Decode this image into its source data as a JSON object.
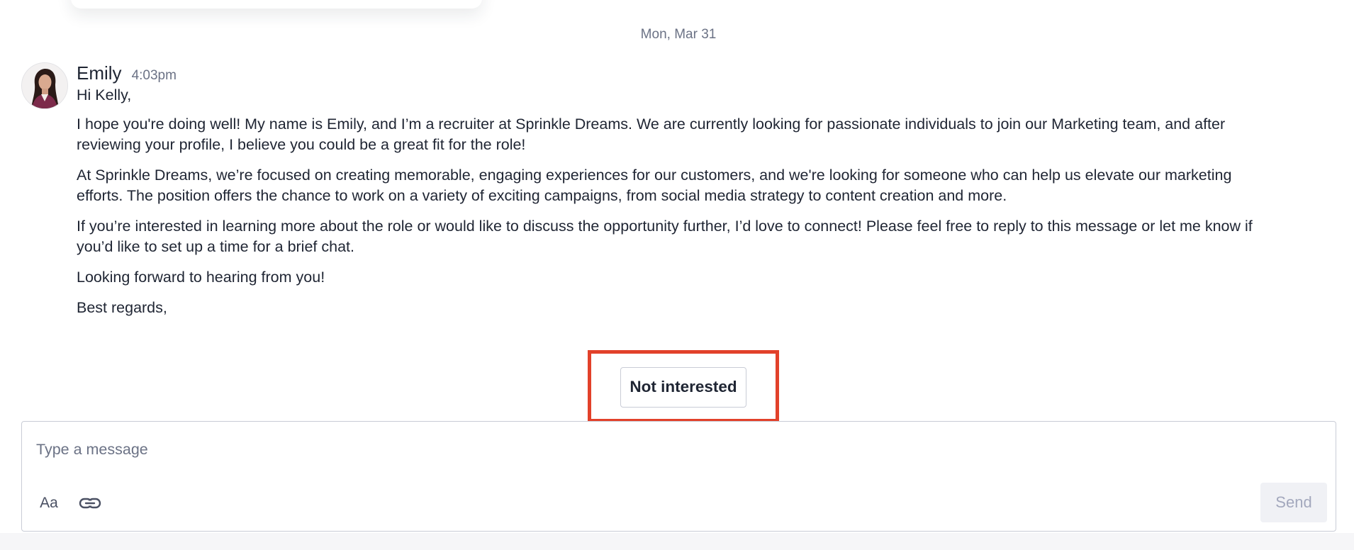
{
  "conversation": {
    "date_divider": "Mon, Mar 31"
  },
  "message": {
    "sender": "Emily",
    "time": "4:03pm",
    "avatar_icon": "avatar-photo",
    "paragraphs": [
      "Hi Kelly,",
      "I hope you're doing well! My name is Emily, and I’m a recruiter at Sprinkle Dreams. We are currently looking for passionate individuals to join our Marketing team, and after reviewing your profile, I believe you could be a great fit for the role!",
      "At Sprinkle Dreams, we’re focused on creating memorable, engaging experiences for our customers, and we're looking for someone who can help us elevate our marketing efforts. The position offers the chance to work on a variety of exciting campaigns, from social media strategy to content creation and more.",
      "If you’re interested in learning more about the role or would like to discuss the opportunity further, I’d love to connect! Please feel free to reply to this message or let me know if you’d like to set up a time for a brief chat.",
      "Looking forward to hearing from you!",
      "Best regards,"
    ]
  },
  "actions": {
    "not_interested_label": "Not interested",
    "highlight_color": "#e2412a"
  },
  "composer": {
    "placeholder": "Type a message",
    "value": "",
    "format_label": "Aa",
    "link_icon": "link-icon",
    "send_label": "Send"
  }
}
